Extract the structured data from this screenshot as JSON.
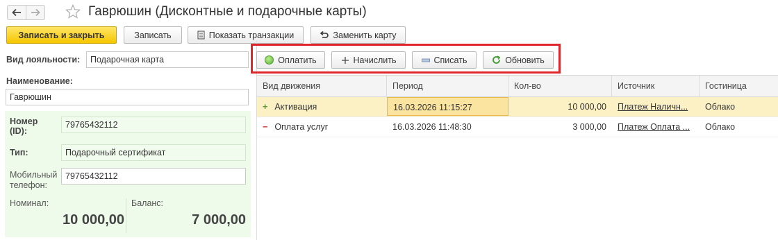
{
  "window": {
    "title": "Гаврюшин (Дисконтные и подарочные карты)"
  },
  "toolbar": {
    "save_close": "Записать и закрыть",
    "save": "Записать",
    "show_transactions": "Показать транзакции",
    "replace_card": "Заменить карту"
  },
  "form": {
    "loyalty_type_label": "Вид лояльности:",
    "loyalty_type_value": "Подарочная карта",
    "name_label": "Наименование:",
    "name_value": "Гаврюшин",
    "card": {
      "number_label_1": "Номер",
      "number_label_2": "(ID):",
      "number_value": "79765432112",
      "type_label": "Тип:",
      "type_value": "Подарочный сертификат",
      "phone_label_1": "Мобильный",
      "phone_label_2": "телефон:",
      "phone_value": "79765432112",
      "nominal_label": "Номинал:",
      "nominal_value": "10 000,00",
      "balance_label": "Баланс:",
      "balance_value": "7 000,00"
    }
  },
  "actions": {
    "pay": "Оплатить",
    "accrue": "Начислить",
    "write_off": "Списать",
    "refresh": "Обновить"
  },
  "table": {
    "columns": [
      "Вид движения",
      "Период",
      "Кол-во",
      "Источник",
      "Гостиница"
    ],
    "rows": [
      {
        "sign": "+",
        "type": "Активация",
        "period": "16.03.2026 11:15:27",
        "qty": "10 000,00",
        "source": "Платеж Наличн...",
        "hotel": "Облако"
      },
      {
        "sign": "−",
        "type": "Оплата услуг",
        "period": "16.03.2026 11:48:30",
        "qty": "3 000,00",
        "source": "Платеж Оплата ...",
        "hotel": "Облако"
      }
    ]
  },
  "colors": {
    "primary_button": "#f5c700",
    "highlight_border": "#e0252b",
    "selected_row": "#fcf1c4",
    "card_panel": "#eefbea"
  }
}
